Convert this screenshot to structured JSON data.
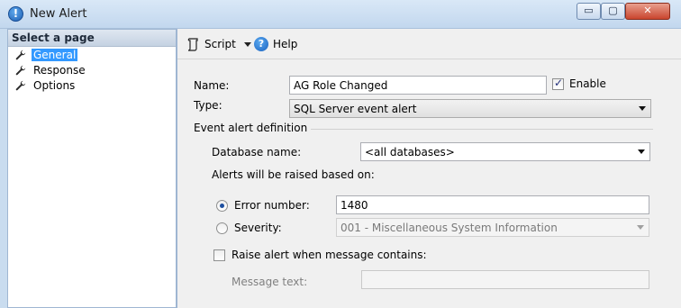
{
  "window": {
    "title": "New Alert",
    "min_label": "▭",
    "max_label": "▢",
    "close_label": "✕"
  },
  "left": {
    "header": "Select a page",
    "items": [
      {
        "label": "General",
        "icon": "wrench-icon",
        "selected": true
      },
      {
        "label": "Response",
        "icon": "wrench-icon",
        "selected": false
      },
      {
        "label": "Options",
        "icon": "wrench-icon",
        "selected": false
      }
    ]
  },
  "toolbar": {
    "script_label": "Script",
    "help_label": "Help",
    "help_glyph": "?"
  },
  "form": {
    "name_label": "Name:",
    "name_value": "AG Role Changed",
    "enable_label": "Enable",
    "enable_checked": true,
    "type_label": "Type:",
    "type_value": "SQL Server event alert",
    "event_group_label": "Event alert definition",
    "database_label": "Database name:",
    "database_value": "<all databases>",
    "raised_label": "Alerts will be raised based on:",
    "error_number_label": "Error number:",
    "error_number_value": "1480",
    "error_number_selected": true,
    "severity_label": "Severity:",
    "severity_value": "001 - Miscellaneous System Information",
    "raise_contains_label": "Raise alert when message contains:",
    "raise_contains_checked": false,
    "message_text_label": "Message text:",
    "message_text_value": ""
  },
  "colors": {
    "selection": "#3399ff",
    "frame": "#c9dcef"
  }
}
